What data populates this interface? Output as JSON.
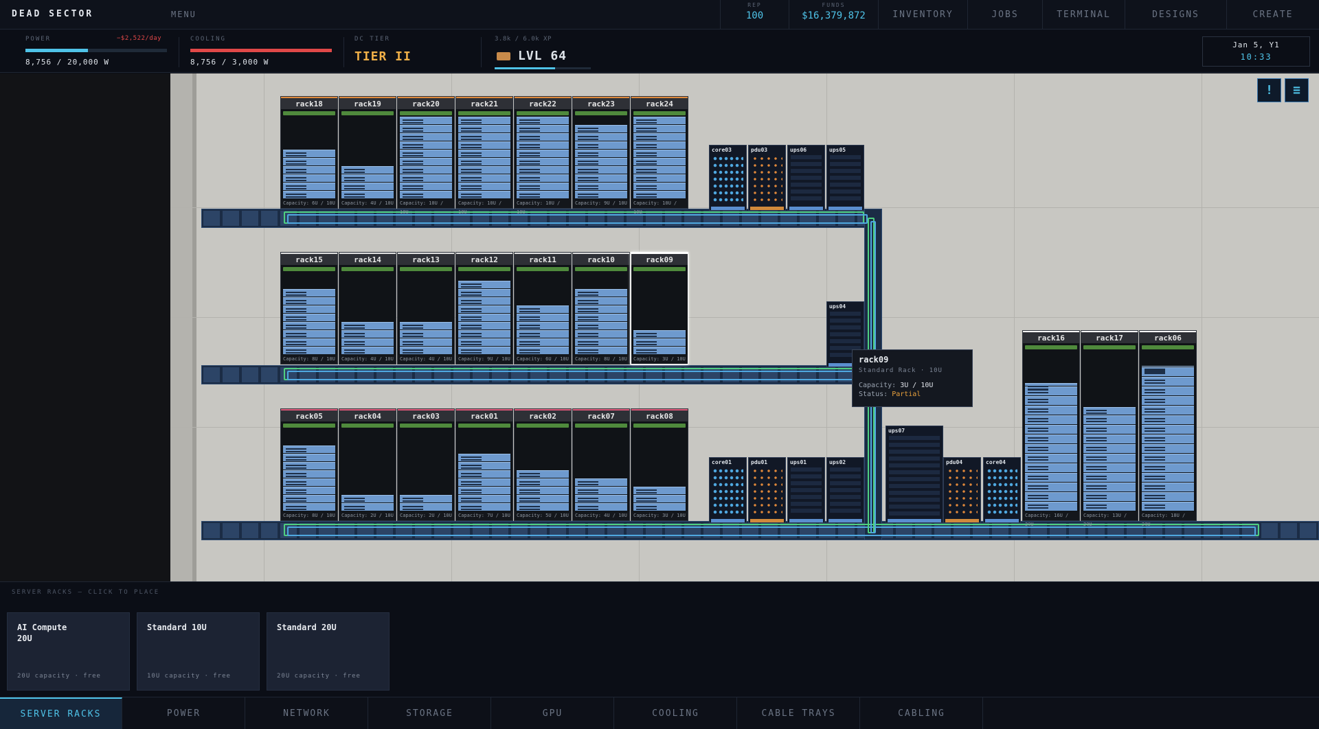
{
  "app": {
    "title": "DEAD SECTOR",
    "menu": "MENU"
  },
  "stats": {
    "rep_label": "REP",
    "rep": "100",
    "funds_label": "FUNDS",
    "funds": "$16,379,872"
  },
  "nav": [
    "INVENTORY",
    "JOBS",
    "TERMINAL",
    "DESIGNS",
    "CREATE"
  ],
  "power": {
    "label": "POWER",
    "cost": "−$2,522/day",
    "value": "8,756 / 20,000 W",
    "fraction": 0.44
  },
  "cooling": {
    "label": "COOLING",
    "value": "8,756 / 3,000 W",
    "fraction": 1.0
  },
  "tier": {
    "label": "DC TIER",
    "value": "TIER II"
  },
  "xp": {
    "value": "3.8k / 6.0k XP",
    "level": "LVL 64",
    "fraction": 0.63
  },
  "clock": {
    "date": "Jan 5, Y1",
    "time": "10:33"
  },
  "floor_buttons": {
    "alert": "!",
    "list": "≡"
  },
  "racks": [
    {
      "name": "rack18",
      "cap": "Capacity: 6U / 10U",
      "level": 0.6
    },
    {
      "name": "rack19",
      "cap": "Capacity: 4U / 10U",
      "level": 0.4
    },
    {
      "name": "rack20",
      "cap": "Capacity: 10U / 10U",
      "level": 1.0
    },
    {
      "name": "rack21",
      "cap": "Capacity: 10U / 10U",
      "level": 1.0
    },
    {
      "name": "rack22",
      "cap": "Capacity: 10U / 10U",
      "level": 1.0
    },
    {
      "name": "rack23",
      "cap": "Capacity: 9U / 10U",
      "level": 0.9
    },
    {
      "name": "rack24",
      "cap": "Capacity: 10U / 10U",
      "level": 1.0
    },
    {
      "name": "rack15",
      "cap": "Capacity: 8U / 10U",
      "level": 0.8
    },
    {
      "name": "rack14",
      "cap": "Capacity: 4U / 10U",
      "level": 0.4
    },
    {
      "name": "rack13",
      "cap": "Capacity: 4U / 10U",
      "level": 0.4
    },
    {
      "name": "rack12",
      "cap": "Capacity: 9U / 10U",
      "level": 0.9
    },
    {
      "name": "rack11",
      "cap": "Capacity: 6U / 10U",
      "level": 0.6
    },
    {
      "name": "rack10",
      "cap": "Capacity: 8U / 10U",
      "level": 0.8
    },
    {
      "name": "rack09",
      "cap": "Capacity: 3U / 10U",
      "level": 0.3
    },
    {
      "name": "rack05",
      "cap": "Capacity: 8U / 10U",
      "level": 0.8
    },
    {
      "name": "rack04",
      "cap": "Capacity: 2U / 10U",
      "level": 0.2
    },
    {
      "name": "rack03",
      "cap": "Capacity: 2U / 10U",
      "level": 0.2
    },
    {
      "name": "rack01",
      "cap": "Capacity: 7U / 10U",
      "level": 0.7
    },
    {
      "name": "rack02",
      "cap": "Capacity: 5U / 10U",
      "level": 0.5
    },
    {
      "name": "rack07",
      "cap": "Capacity: 4U / 10U",
      "level": 0.4
    },
    {
      "name": "rack08",
      "cap": "Capacity: 3U / 10U",
      "level": 0.3
    },
    {
      "name": "rack16",
      "cap": "Capacity: 16U / 20U",
      "level": 0.8
    },
    {
      "name": "rack17",
      "cap": "Capacity: 13U / 20U",
      "level": 0.65
    },
    {
      "name": "rack06",
      "cap": "Capacity: 18U / 20U",
      "level": 0.9
    }
  ],
  "devices": [
    {
      "name": "core03",
      "kind": "core"
    },
    {
      "name": "pdu03",
      "kind": "pdu"
    },
    {
      "name": "ups06",
      "kind": "ups"
    },
    {
      "name": "ups05",
      "kind": "ups"
    },
    {
      "name": "ups04",
      "kind": "ups"
    },
    {
      "name": "core01",
      "kind": "core"
    },
    {
      "name": "pdu01",
      "kind": "pdu"
    },
    {
      "name": "ups01",
      "kind": "ups"
    },
    {
      "name": "ups02",
      "kind": "ups"
    },
    {
      "name": "ups07",
      "kind": "ups"
    },
    {
      "name": "pdu04",
      "kind": "pdu"
    },
    {
      "name": "core04",
      "kind": "core"
    }
  ],
  "tooltip": {
    "name": "rack09",
    "type": "Standard Rack  ·  10U",
    "cap_label": "Capacity:",
    "cap": "3U / 10U",
    "status_label": "Status:",
    "status": "Partial"
  },
  "palette": {
    "label": "SERVER RACKS — CLICK TO PLACE",
    "items": [
      {
        "name": "AI Compute 20U",
        "sub": "20U capacity  ·  free"
      },
      {
        "name": "Standard 10U",
        "sub": "10U capacity  ·  free"
      },
      {
        "name": "Standard 20U",
        "sub": "20U capacity  ·  free"
      }
    ]
  },
  "tabs": [
    "SERVER RACKS",
    "POWER",
    "NETWORK",
    "STORAGE",
    "GPU",
    "COOLING",
    "CABLE TRAYS",
    "CABLING"
  ],
  "colors": {
    "accent": "#4fc3e8",
    "warning": "#e8a03c",
    "danger": "#e04848",
    "ok": "#4f8a3c"
  }
}
